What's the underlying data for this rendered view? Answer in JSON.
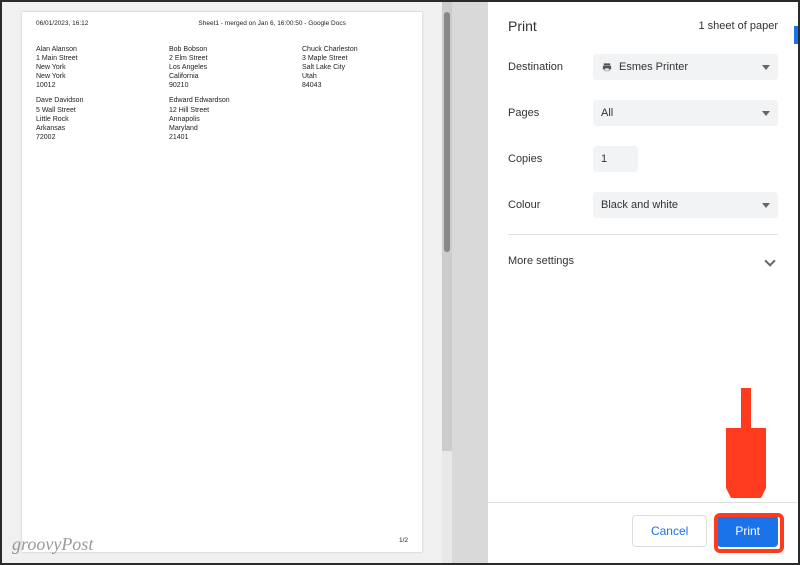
{
  "preview": {
    "timestamp": "06/01/2023, 16:12",
    "doc_title": "Sheet1 - merged on Jan 6, 16:00:50 - Google Docs",
    "page_indicator": "1/2",
    "columns": [
      [
        "Alan Alanson\n1 Main Street\nNew York\nNew York\n10012",
        "Dave Davidson\n5 Wall Street\nLittle Rock\nArkansas\n72002"
      ],
      [
        "Bob Bobson\n2 Elm Street\nLos Angeles\nCalifornia\n90210",
        "Edward Edwardson\n12 Hill Street\nAnnapolis\nMaryland\n21401"
      ],
      [
        "Chuck Charleston\n3 Maple Street\nSalt Lake City\nUtah\n84043"
      ]
    ]
  },
  "panel": {
    "title": "Print",
    "sheet_count": "1 sheet of paper",
    "destination_label": "Destination",
    "destination_value": "Esmes Printer",
    "pages_label": "Pages",
    "pages_value": "All",
    "copies_label": "Copies",
    "copies_value": "1",
    "colour_label": "Colour",
    "colour_value": "Black and white",
    "more_settings": "More settings",
    "cancel": "Cancel",
    "print": "Print"
  },
  "watermark": "groovyPost"
}
